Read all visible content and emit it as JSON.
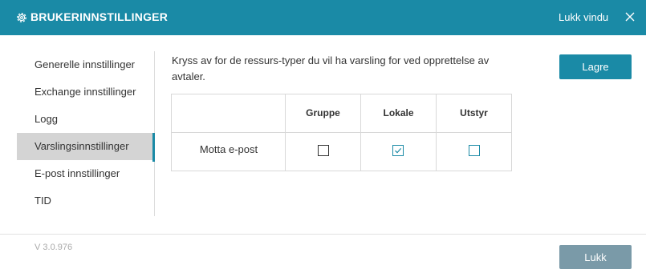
{
  "header": {
    "title": "BRUKERINNSTILLINGER",
    "close_text": "Lukk vindu",
    "icons": {
      "settings": "gear-icon",
      "close": "close-icon"
    }
  },
  "sidebar": {
    "items": [
      {
        "label": "Generelle innstillinger",
        "active": false
      },
      {
        "label": "Exchange innstillinger",
        "active": false
      },
      {
        "label": "Logg",
        "active": false
      },
      {
        "label": "Varslingsinnstillinger",
        "active": true
      },
      {
        "label": "E-post innstillinger",
        "active": false
      },
      {
        "label": "TID",
        "active": false
      }
    ]
  },
  "main": {
    "description": "Kryss av for de ressurs-typer du vil ha varsling for ved opprettelse av avtaler.",
    "save_label": "Lagre",
    "table": {
      "columns": [
        "Gruppe",
        "Lokale",
        "Utstyr"
      ],
      "rows": [
        {
          "label": "Motta e-post",
          "values": [
            false,
            true,
            false
          ]
        }
      ]
    }
  },
  "footer": {
    "version": "V 3.0.976",
    "close_label": "Lukk"
  },
  "colors": {
    "accent": "#1a8aa6",
    "active_item_bg": "#d4d4d4",
    "disabled_button": "#7a9aa8"
  }
}
